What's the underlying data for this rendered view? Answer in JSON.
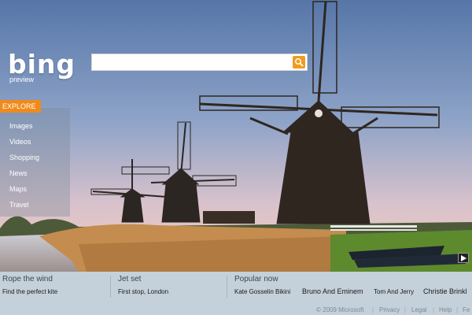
{
  "logo": {
    "text": "bing",
    "sub": "preview"
  },
  "search": {
    "value": "",
    "placeholder": ""
  },
  "explore": {
    "tab_label": "EXPLORE",
    "items": [
      "Images",
      "Videos",
      "Shopping",
      "News",
      "Maps",
      "Travel"
    ]
  },
  "bottom": {
    "sections": [
      {
        "title": "Rope the wind",
        "link": "Find the perfect kite"
      },
      {
        "title": "Jet set",
        "link": "First stop, London"
      }
    ],
    "popular": {
      "title": "Popular now",
      "items": [
        "Kate Gosselin Bikini",
        "Bruno And Eminem",
        "Tom And Jerry",
        "Christie Brinkl"
      ]
    }
  },
  "footer": {
    "copyright": "© 2009 Microsoft",
    "links": [
      "Privacy",
      "Legal",
      "Help",
      "Fe"
    ]
  },
  "colors": {
    "accent": "#f08a1c",
    "sky_top": "#5878a8",
    "sky_bottom": "#f2c8b6"
  }
}
